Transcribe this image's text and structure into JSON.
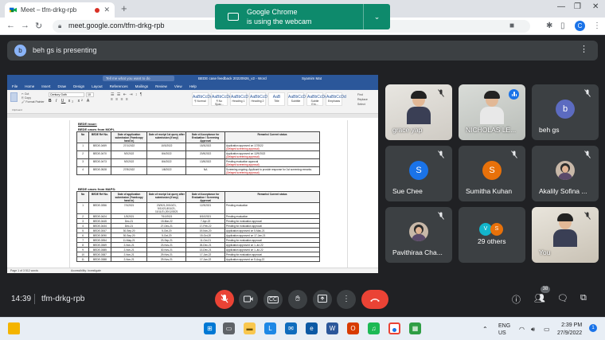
{
  "browser": {
    "tab_title": "Meet – tfm-drkg-rpb",
    "url": "meet.google.com/tfm-drkg-rpb",
    "profile_initial": "C"
  },
  "camera_notice": {
    "line1": "Google Chrome",
    "line2": "is using the webcam"
  },
  "presenting_banner": {
    "avatar_initial": "b",
    "text": "beh gs is presenting"
  },
  "word": {
    "title_doc": "BEDE case feedback 20220926_v2 - Word",
    "search_placeholder": "Tell me what you want to do",
    "user": "Syamim Mat",
    "menu": [
      "File",
      "Home",
      "Insert",
      "Draw",
      "Design",
      "Layout",
      "References",
      "Mailings",
      "Review",
      "View",
      "Help"
    ],
    "font_name": "Century Goth",
    "font_size": "10",
    "clipboard_label": "Clipboard",
    "styles": [
      {
        "sample": "AaBbCcDd",
        "label": "¶ Normal"
      },
      {
        "sample": "AaBbCcDd",
        "label": "¶ No Spac..."
      },
      {
        "sample": "AaBbCcD",
        "label": "Heading 1"
      },
      {
        "sample": "AaBbCcD",
        "label": "Heading 2"
      },
      {
        "sample": "AaB",
        "label": "Title"
      },
      {
        "sample": "AaBbCcD",
        "label": "Subtitle"
      },
      {
        "sample": "AaBbCcDd",
        "label": "Subtle Em..."
      },
      {
        "sample": "AaBbCcDd",
        "label": "Emphasis"
      }
    ],
    "editing": [
      "Find",
      "Replace",
      "Select"
    ],
    "doc_heading": "BEDE issue:",
    "section1_title": "BEDE cases from MOPL",
    "section2_title": "BEDE cases from MAPS:",
    "headers": [
      "No",
      "BEDE Ref No.",
      "Date of application submission (*hardcopy hand in)",
      "Date of receipt 1st query after submission (if any)",
      "Date of Acceptance for Evaluation / Screening Approval",
      "Remarks/ Current status"
    ],
    "table1": [
      {
        "no": "1",
        "ref": "BEDE-0459",
        "sub": "27/1/2022",
        "q": "10/3/2022",
        "acc": "15/3/2022",
        "rem": "Application approved on 17/2022",
        "note": "(Delayed screening approval)"
      },
      {
        "no": "2",
        "ref": "BEDE-0470",
        "sub": "9/2/2022",
        "q": "8/4/2022",
        "acc": "20/5/2022",
        "rem": "Application approved on 12/9/2022",
        "note": "(Delayed screening approval)"
      },
      {
        "no": "3",
        "ref": "BEDE-0473",
        "sub": "9/2/2022",
        "q": "8/4/2022",
        "acc": "13/5/2022",
        "rem": "Pending evaluation approval",
        "note": "(Delayed screening approval)"
      },
      {
        "no": "4",
        "ref": "BEDE-0528",
        "sub": "27/5/2022",
        "q": "1/8/2022",
        "acc": "NA",
        "rem": "Screening ongoing. Applicant to provide response for 1st screening remarks.",
        "note": "(Delayed screening approval)"
      }
    ],
    "table2": [
      {
        "no": "1",
        "ref": "BEDE-0356",
        "sub": "7/1/2021",
        "q": "23/3/21,20/10/21, 5/11/21,8/11/21, 11/11/21,20/12/2021",
        "acc": "12/3/2021",
        "rem": "Pending evaluation"
      },
      {
        "no": "2",
        "ref": "BEDE-0424",
        "sub": "1/3/2021",
        "q": "7/10/2021",
        "acc": "8/10/2021",
        "rem": "Pending evaluation"
      },
      {
        "no": "3",
        "ref": "BEDE-0445",
        "sub": "Dec-21",
        "q": "15-Mar-22",
        "acc": "7-Apr-22",
        "rem": "Pending for evaluation approval"
      },
      {
        "no": "4",
        "ref": "BEDE-0434",
        "sub": "Dec-21",
        "q": "27-Dec-21",
        "acc": "17-Feb-22",
        "rem": "Pending for evaluation approval"
      },
      {
        "no": "5",
        "ref": "BEDE-0347",
        "sub": "30-Sep-20",
        "q": "5-Oct-20",
        "acc": "19-Nov-20",
        "rem": "Application approved on 5-Mac-21"
      },
      {
        "no": "6",
        "ref": "BEDE-0090",
        "sub": "30-Sep-20",
        "q": "5-Oct-20",
        "acc": "15-Oct-20",
        "rem": "Application approved on 17-Jan-21"
      },
      {
        "no": "7",
        "ref": "BEDE-0354",
        "sub": "11-May-21",
        "q": "23-Sep-21",
        "acc": "11-Oct-21",
        "rem": "Pending for evaluation approval"
      },
      {
        "no": "8",
        "ref": "BEDE-0369",
        "sub": "2-Nov-21",
        "q": "23-Nov-21",
        "acc": "26-Dec-21",
        "rem": "Application approved on 1-Jul-22"
      },
      {
        "no": "9",
        "ref": "BEDE-0385",
        "sub": "2-Nov-21",
        "q": "30-Nov-21",
        "acc": "13-Dec-21",
        "rem": "Application approved on 1-Jul-22"
      },
      {
        "no": "10",
        "ref": "BEDE-0387",
        "sub": "2-Nov-21",
        "q": "29-Nov-21",
        "acc": "17-Jan-22",
        "rem": "Pending for evaluation approval"
      },
      {
        "no": "11",
        "ref": "BEDE-0388",
        "sub": "2-Nov-21",
        "q": "29-Nov-21",
        "acc": "17-Jan-22",
        "rem": "Application approved on 5-Aug-22"
      }
    ],
    "status_left": "Page 1 of 3   512 words",
    "status_right": "Accessibility: Investigate"
  },
  "participants": [
    {
      "name": "grace yap",
      "type": "video",
      "muted": true
    },
    {
      "name": "NICHOLAS LE...",
      "type": "video",
      "muted": false,
      "speaking": true
    },
    {
      "name": "beh gs",
      "type": "avatar",
      "initial": "b",
      "color": "#5c6bc0",
      "muted": true
    },
    {
      "name": "Sue Chee",
      "type": "avatar",
      "initial": "S",
      "color": "#1a73e8",
      "muted": true
    },
    {
      "name": "Sumitha Kuhan",
      "type": "avatar",
      "initial": "S",
      "color": "#e8710a",
      "muted": true
    },
    {
      "name": "Akalily Sofina ...",
      "type": "photo",
      "muted": true
    },
    {
      "name": "Pavithiraa Cha...",
      "type": "photo",
      "muted": true
    },
    {
      "name": "29 others",
      "type": "others",
      "muted": false
    },
    {
      "name": "You",
      "type": "video",
      "muted": true
    }
  ],
  "others_avatars": [
    {
      "initial": "V",
      "color": "#12b5cb"
    },
    {
      "initial": "S",
      "color": "#e8710a"
    }
  ],
  "controls": {
    "time": "14:39",
    "code": "tfm-drkg-rpb",
    "participant_count": "38"
  },
  "taskbar": {
    "lang1": "ENG",
    "lang2": "US",
    "time": "2:39 PM",
    "date": "27/9/2022",
    "notif_count": "1"
  },
  "colors": {
    "meet_bg": "#202124",
    "tile_bg": "#3c4043",
    "end_call": "#ea4335",
    "accent": "#1a73e8",
    "camera_notice": "#0e8a6c",
    "word_blue": "#2b579a"
  }
}
